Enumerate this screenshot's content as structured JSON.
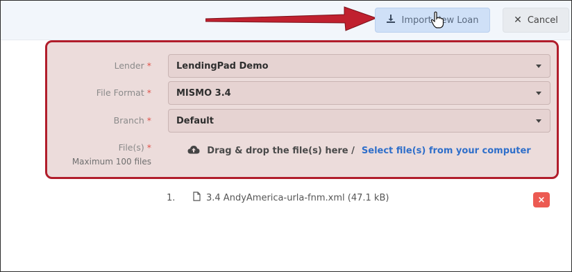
{
  "toolbar": {
    "import_label": "Import New Loan",
    "cancel_label": "Cancel",
    "import_icon": "download-icon",
    "cancel_icon": "close-icon"
  },
  "form": {
    "required_mark": "*",
    "lender": {
      "label": "Lender",
      "value": "LendingPad Demo"
    },
    "file_format": {
      "label": "File Format",
      "value": "MISMO 3.4"
    },
    "branch": {
      "label": "Branch",
      "value": "Default"
    },
    "files": {
      "label": "File(s)",
      "sublabel": "Maximum 100 files",
      "drop_text": "Drag & drop the file(s) here /",
      "select_link": "Select file(s) from your computer",
      "upload_icon": "cloud-upload-icon"
    }
  },
  "file_list": [
    {
      "index": "1.",
      "name": "3.4 AndyAmerica-urla-fnm.xml (47.1 kB)",
      "icon": "file-icon",
      "delete_symbol": "×"
    }
  ],
  "colors": {
    "annotation_red": "#b11d2b",
    "highlight_fill": "#ecdcdb",
    "link_blue": "#2f6fca",
    "delete_red": "#ec5a52",
    "import_bg": "#cfe0f7"
  }
}
